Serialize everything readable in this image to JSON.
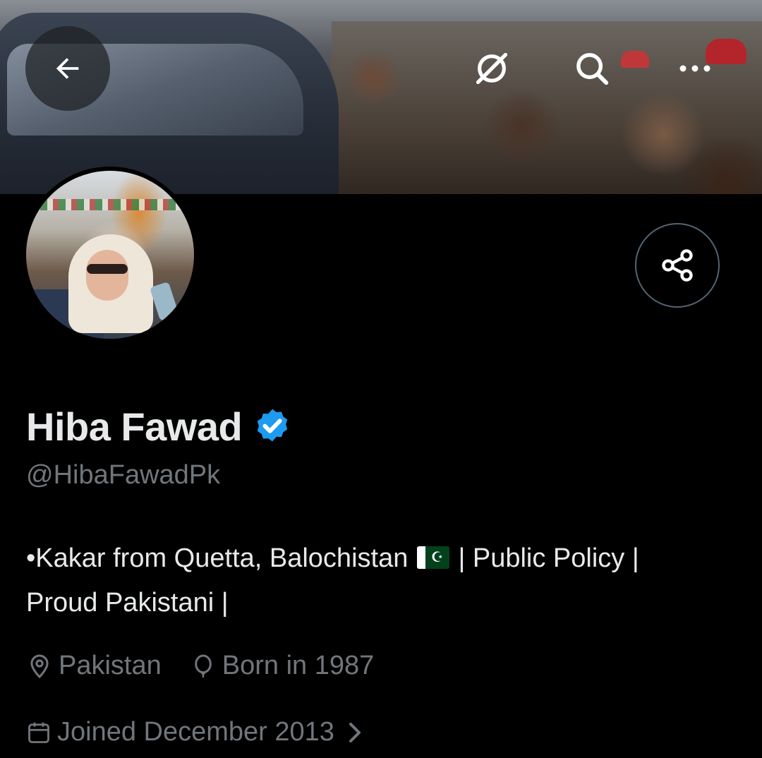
{
  "header": {
    "back_icon": "arrow-left-icon",
    "hide_icon": "eye-off-icon",
    "search_icon": "search-icon",
    "more_icon": "more-horizontal-icon"
  },
  "profile": {
    "name": "Hiba Fawad",
    "verified": true,
    "verified_color": "#1d9bf0",
    "handle": "@HibaFawadPk",
    "bio_line1_before_flag": "•Kakar from Quetta, Balochistan ",
    "bio_line1_after_flag": " | Public Policy |",
    "bio_line2": "Proud Pakistani |",
    "location": "Pakistan",
    "birth": "Born in 1987",
    "joined": "Joined December 2013"
  },
  "colors": {
    "background": "#000000",
    "primary_text": "#e7e9ea",
    "secondary_text": "#71767b",
    "border": "#536471",
    "accent": "#1d9bf0"
  }
}
